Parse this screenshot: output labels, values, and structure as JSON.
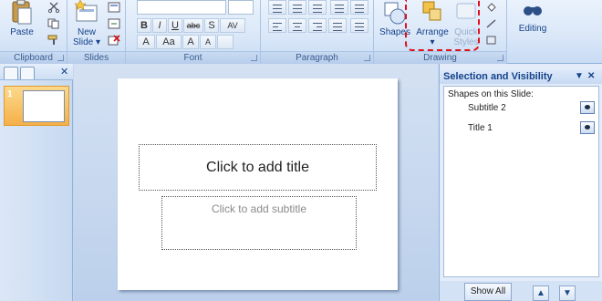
{
  "ribbon": {
    "groups": {
      "clipboard": "Clipboard",
      "slides": "Slides",
      "font": "Font",
      "paragraph": "Paragraph",
      "drawing": "Drawing"
    },
    "buttons": {
      "paste": "Paste",
      "new_slide_line1": "New",
      "new_slide_line2": "Slide",
      "shapes": "Shapes",
      "arrange": "Arrange",
      "quick_styles_line1": "Quick",
      "quick_styles_line2": "Styles",
      "editing": "Editing"
    },
    "font_buttons": {
      "bold": "B",
      "italic": "I",
      "underline": "U",
      "strike": "abc",
      "shadow": "S",
      "spacing": "AV",
      "grow": "A",
      "case": "Aa",
      "grow_font": "A",
      "shrink_font": "A"
    }
  },
  "slide_pane": {
    "slide_number": "1"
  },
  "slide": {
    "title_placeholder": "Click to add title",
    "subtitle_placeholder": "Click to add subtitle"
  },
  "selection_pane": {
    "title": "Selection and Visibility",
    "dropdown_glyph": "▼",
    "close_glyph": "✕",
    "shapes_label": "Shapes on this Slide:",
    "shapes": [
      {
        "name": "Subtitle 2"
      },
      {
        "name": "Title 1"
      }
    ],
    "show_all": "Show All",
    "move_up_glyph": "▲",
    "move_down_glyph": "▼"
  },
  "colors": {
    "callout": "#e0111b",
    "ribbon_text": "#15428b",
    "thumb_selected": "#f5b04a"
  }
}
